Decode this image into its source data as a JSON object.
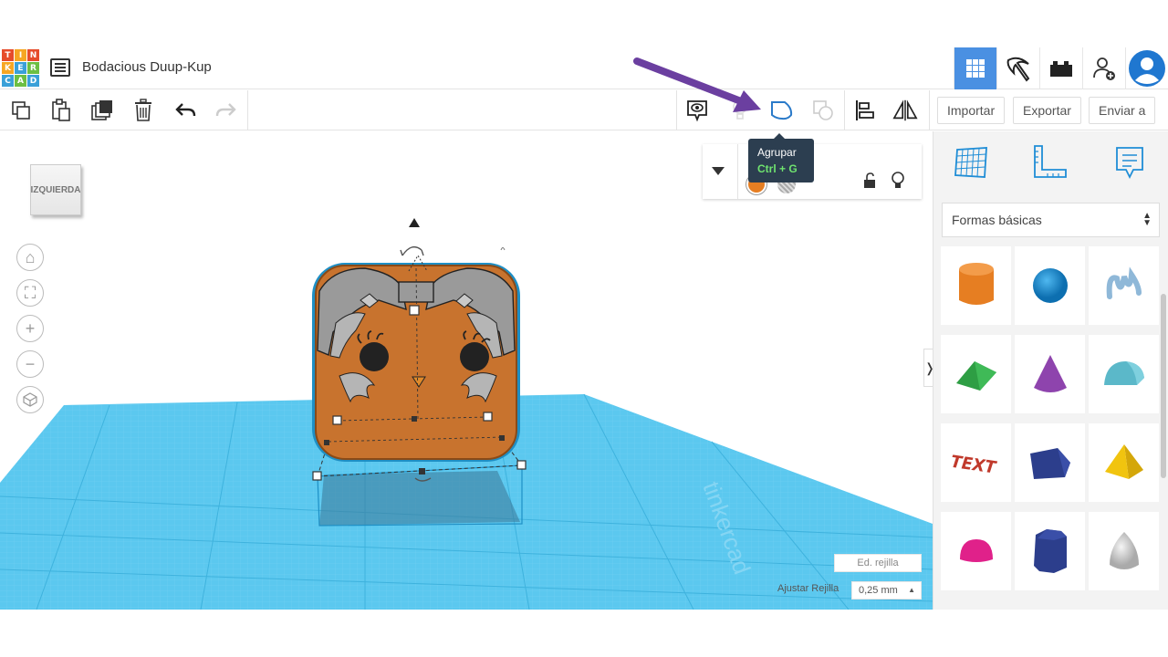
{
  "app": {
    "logo_letters": [
      "T",
      "I",
      "N",
      "K",
      "E",
      "R",
      "C",
      "A",
      "D"
    ],
    "logo_colors": [
      "#e64c2b",
      "#f6a623",
      "#e64c2b",
      "#f6a623",
      "#3aa0d8",
      "#6cbf43",
      "#3aa0d8",
      "#6cbf43",
      "#3aa0d8"
    ],
    "title": "Bodacious Duup-Kup"
  },
  "colors": {
    "accent": "#4a90e2",
    "grid": "#5bc8ef",
    "object": "#c8732e",
    "arrow": "#6b3fa0"
  },
  "topbar": {
    "buttons": [
      "grid-view-icon",
      "pickaxe-icon",
      "bricks-icon",
      "add-user-icon",
      "avatar"
    ]
  },
  "toolbar": {
    "icons": [
      "copy-icon",
      "paste-icon",
      "duplicate-icon",
      "trash-icon",
      "undo-icon",
      "redo-icon",
      "note-icon",
      "light-icon",
      "group-icon",
      "ungroup-icon",
      "align-icon",
      "mirror-icon"
    ],
    "import_label": "Importar",
    "export_label": "Exportar",
    "send_label": "Enviar a"
  },
  "tooltip": {
    "title": "Agrupar",
    "shortcut": "Ctrl + G"
  },
  "viewport": {
    "viewcube_label": "IZQUIERDA",
    "edit_grid_label": "Ed. rejilla",
    "snap_grid_label": "Ajustar Rejilla",
    "snap_grid_value": "0,25 mm"
  },
  "sidebar": {
    "tabs": [
      "workplane-icon",
      "ruler-icon",
      "notes-icon"
    ],
    "category": "Formas básicas",
    "shapes": [
      {
        "name": "cylinder",
        "color": "#e67e22"
      },
      {
        "name": "sphere",
        "color": "#1e90d6"
      },
      {
        "name": "scribble",
        "color": "#8fb8d8"
      },
      {
        "name": "roof",
        "color": "#2e9e44"
      },
      {
        "name": "cone",
        "color": "#8e44ad"
      },
      {
        "name": "round-roof",
        "color": "#5bb8c9"
      },
      {
        "name": "text",
        "color": "#c0392b"
      },
      {
        "name": "box",
        "color": "#2c3e8c"
      },
      {
        "name": "pyramid",
        "color": "#f1c40f"
      },
      {
        "name": "half-sphere",
        "color": "#e0218a"
      },
      {
        "name": "polygon",
        "color": "#2c3e8c"
      },
      {
        "name": "paraboloid",
        "color": "#cccccc"
      }
    ]
  }
}
